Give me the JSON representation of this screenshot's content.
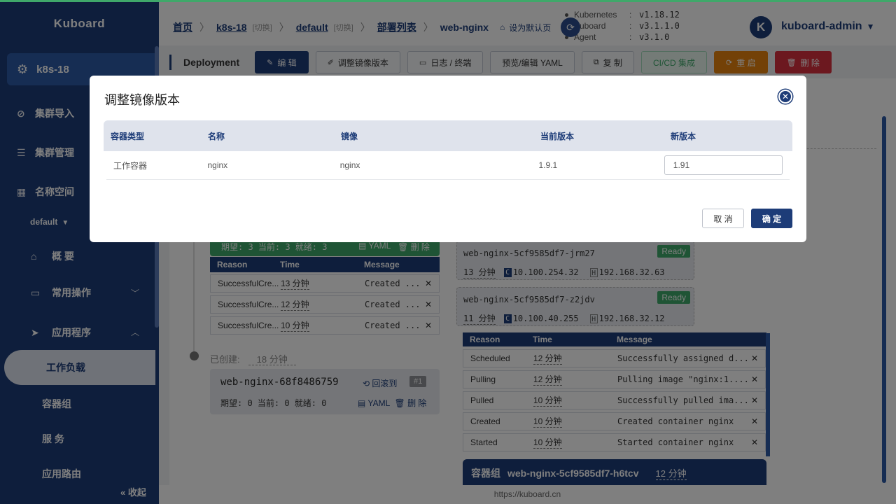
{
  "sidebar": {
    "brand": "Kuboard",
    "cluster": "k8s-18",
    "items": [
      {
        "label": "集群导入"
      },
      {
        "label": "集群管理"
      },
      {
        "label": "名称空间"
      }
    ],
    "namespace": "default",
    "sub_items": [
      {
        "label": "概 要"
      },
      {
        "label": "常用操作"
      },
      {
        "label": "应用程序"
      }
    ],
    "active": "工作负载",
    "leaves": [
      {
        "label": "容器组"
      },
      {
        "label": "服 务"
      },
      {
        "label": "应用路由"
      }
    ],
    "collapse": "收起"
  },
  "header": {
    "breadcrumb": {
      "home": "首页",
      "cluster": "k8s-18",
      "switch1": "[切换]",
      "namespace": "default",
      "switch2": "[切换]",
      "list": "部署列表",
      "current": "web-nginx",
      "set_default": "设为默认页"
    },
    "versions": [
      {
        "name": "Kubernetes",
        "value": "v1.18.12"
      },
      {
        "name": "Kuboard",
        "value": "v3.1.1.0"
      },
      {
        "name": "Agent",
        "value": "v3.1.0"
      }
    ],
    "avatar": "K",
    "user": "kuboard-admin"
  },
  "toolbar": {
    "title": "Deployment",
    "buttons": [
      {
        "label": "编 辑",
        "icon": "edit-icon"
      },
      {
        "label": "调整镜像版本",
        "icon": "pen-icon"
      },
      {
        "label": "日志 / 终端",
        "icon": "monitor-icon"
      },
      {
        "label": "预览/编辑 YAML"
      },
      {
        "label": "复 制",
        "icon": "copy-icon"
      },
      {
        "label": "CI/CD 集成"
      },
      {
        "label": "重 启",
        "icon": "refresh-icon"
      },
      {
        "label": "删 除",
        "icon": "trash-icon"
      }
    ]
  },
  "content": {
    "rs1_status": "期望: 3 当前: 3 就绪: 3",
    "rs1_yaml": "YAML",
    "rs1_delete": "删 除",
    "event_header": {
      "reason": "Reason",
      "time": "Time",
      "message": "Message"
    },
    "rs1_events": [
      {
        "reason": "SuccessfulCre...",
        "time": "13 分钟",
        "message": "Created ..."
      },
      {
        "reason": "SuccessfulCre...",
        "time": "12 分钟",
        "message": "Created ..."
      },
      {
        "reason": "SuccessfulCre...",
        "time": "10 分钟",
        "message": "Created ..."
      }
    ],
    "created_label": "已创建:",
    "created_time": "18 分钟",
    "rs2": {
      "name": "web-nginx-68f8486759",
      "rollback": "回滚到",
      "badge": "#1",
      "status": "期望: 0 当前: 0 就绪: 0",
      "yaml": "YAML",
      "delete": "删 除"
    },
    "pods": [
      {
        "name": "web-nginx-5cf9585df7-jrm27",
        "status": "Ready",
        "age": "13 分钟",
        "cluster_ip": "10.100.254.32",
        "host_ip": "192.168.32.63"
      },
      {
        "name": "web-nginx-5cf9585df7-z2jdv",
        "status": "Ready",
        "age": "11 分钟",
        "cluster_ip": "10.100.40.255",
        "host_ip": "192.168.32.12"
      }
    ],
    "pod_events": [
      {
        "reason": "Scheduled",
        "time": "12 分钟",
        "message": "Successfully assigned d..."
      },
      {
        "reason": "Pulling",
        "time": "12 分钟",
        "message": "Pulling image \"nginx:1...."
      },
      {
        "reason": "Pulled",
        "time": "10 分钟",
        "message": "Successfully pulled ima..."
      },
      {
        "reason": "Created",
        "time": "10 分钟",
        "message": "Created container nginx"
      },
      {
        "reason": "Started",
        "time": "10 分钟",
        "message": "Started container nginx"
      }
    ],
    "pod_group_label": "容器组",
    "pod_group_name": "web-nginx-5cf9585df7-h6tcv",
    "pod_group_time": "12 分钟"
  },
  "footer": "https://kuboard.cn",
  "dialog": {
    "title": "调整镜像版本",
    "columns": [
      "容器类型",
      "名称",
      "镜像",
      "当前版本",
      "新版本"
    ],
    "rows": [
      {
        "type": "工作容器",
        "name": "nginx",
        "image": "nginx",
        "current": "1.9.1",
        "new": "1.91"
      }
    ],
    "cancel": "取 消",
    "ok": "确 定"
  },
  "colors": {
    "primary": "#1d3c78",
    "success": "#3fa86a",
    "warning": "#e6820e",
    "danger": "#d9303e"
  }
}
